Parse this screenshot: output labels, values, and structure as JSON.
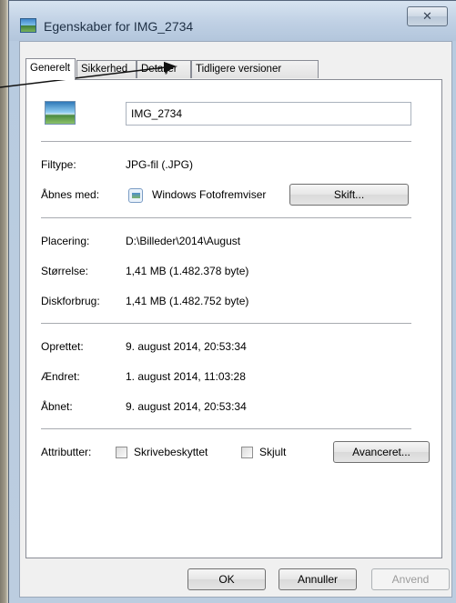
{
  "window": {
    "title": "Egenskaber for IMG_2734",
    "close_glyph": "✕"
  },
  "tabs": [
    {
      "label": "Generelt"
    },
    {
      "label": "Sikkerhed"
    },
    {
      "label": "Detaljer"
    },
    {
      "label": "Tidligere versioner"
    }
  ],
  "general": {
    "file_name": "IMG_2734",
    "filetype_label": "Filtype:",
    "filetype_value": "JPG-fil (.JPG)",
    "opens_with_label": "Åbnes med:",
    "opens_with_value": "Windows Fotofremviser",
    "change_button": "Skift...",
    "location_label": "Placering:",
    "location_value": "D:\\Billeder\\2014\\August",
    "size_label": "Størrelse:",
    "size_value": "1,41 MB (1.482.378 byte)",
    "disk_label": "Diskforbrug:",
    "disk_value": "1,41 MB (1.482.752 byte)",
    "created_label": "Oprettet:",
    "created_value": "9. august 2014, 20:53:34",
    "modified_label": "Ændret:",
    "modified_value": "1. august 2014, 11:03:28",
    "accessed_label": "Åbnet:",
    "accessed_value": "9. august 2014, 20:53:34",
    "attributes_label": "Attributter:",
    "readonly_label": "Skrivebeskyttet",
    "readonly_checked": false,
    "hidden_label": "Skjult",
    "hidden_checked": false,
    "advanced_button": "Avanceret..."
  },
  "footer": {
    "ok": "OK",
    "cancel": "Annuller",
    "apply": "Anvend"
  },
  "icons": {
    "title_icon": "image-file-icon",
    "file_icon": "image-file-icon",
    "app_icon": "photo-viewer-icon"
  }
}
